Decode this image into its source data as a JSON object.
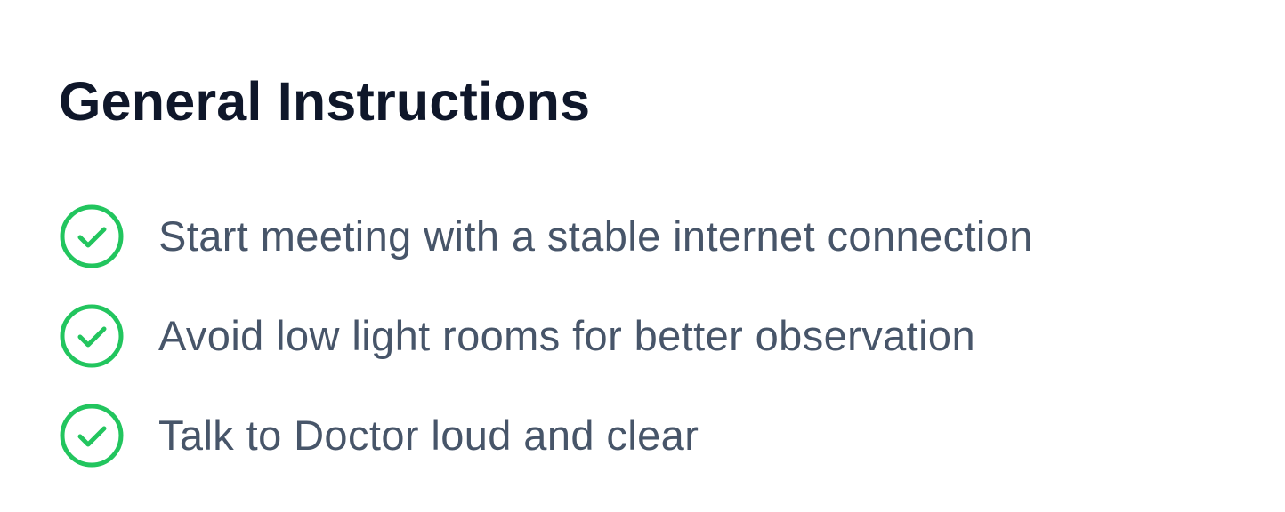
{
  "instructions": {
    "title": "General Instructions",
    "items": [
      {
        "icon": "check-circle-icon",
        "text": "Start meeting with a stable internet connection"
      },
      {
        "icon": "check-circle-icon",
        "text": "Avoid low light rooms for better observation"
      },
      {
        "icon": "check-circle-icon",
        "text": "Talk to Doctor loud and clear"
      }
    ]
  },
  "colors": {
    "title": "#0f172a",
    "text": "#475569",
    "check": "#22c55e",
    "background": "#ffffff"
  }
}
